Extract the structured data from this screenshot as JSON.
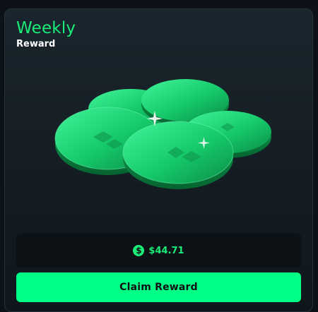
{
  "card": {
    "title": "Weekly",
    "subtitle": "Reward"
  },
  "reward": {
    "currency_icon": "dollar-coin-icon",
    "amount": "$44.71"
  },
  "actions": {
    "claim_label": "Claim Reward"
  },
  "colors": {
    "accent": "#18ee79",
    "button": "#00ff85",
    "card_bg": "#1b252d",
    "page_bg": "#0c1217"
  }
}
